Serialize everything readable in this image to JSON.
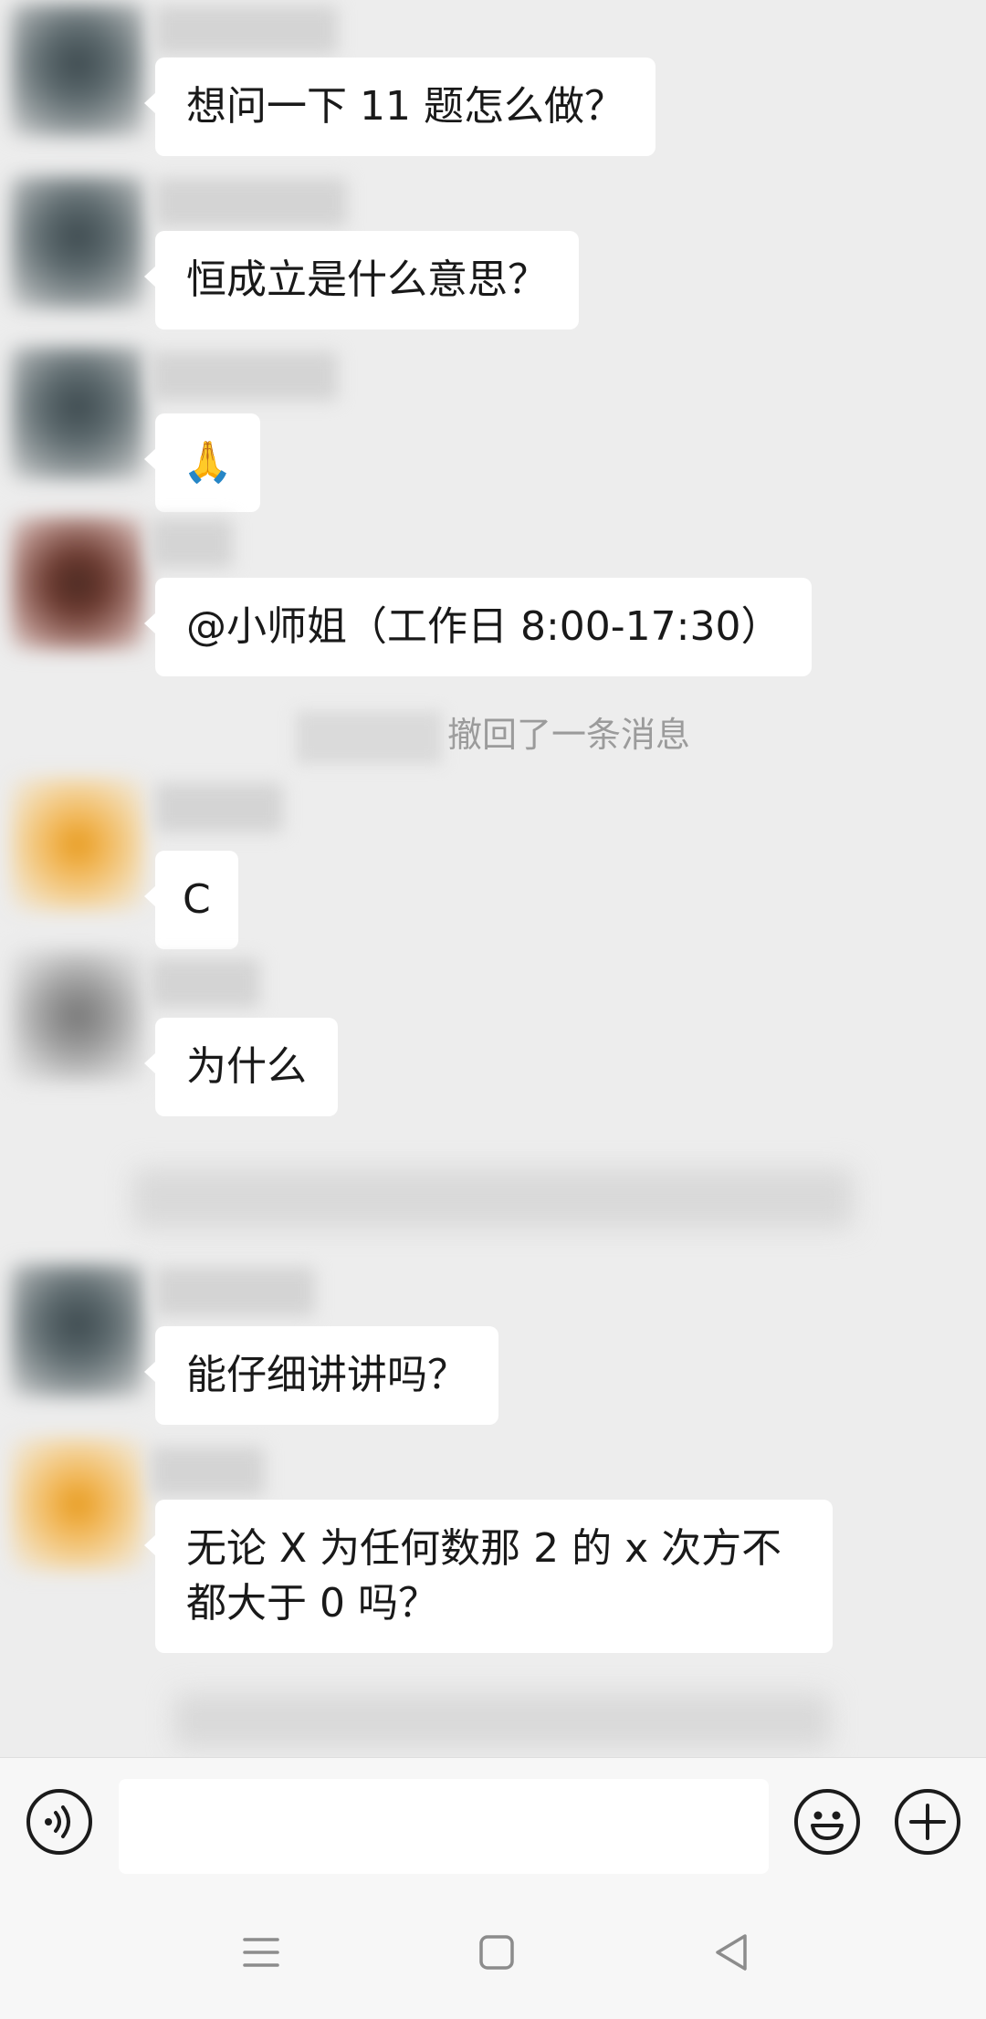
{
  "messages": [
    {
      "text": "想问一下 11 题怎么做？"
    },
    {
      "text": "恒成立是什么意思？"
    },
    {
      "emoji": "🙏"
    },
    {
      "text": "@小师姐（工作日 8:00-17:30）"
    },
    {
      "text": "C"
    },
    {
      "text": "为什么"
    },
    {
      "text": "能仔细讲讲吗？"
    },
    {
      "text": "无论 X 为任何数那 2 的 x 次方不都大于 0 吗？"
    }
  ],
  "system_notice": "撤回了一条消息",
  "icons": {
    "voice": "voice-icon",
    "emoji": "emoji-icon",
    "plus": "plus-icon",
    "menu": "menu-icon",
    "home": "home-icon",
    "back": "back-icon"
  },
  "colors": {
    "background": "#ededed",
    "bubble": "#ffffff",
    "text": "#191919",
    "notice": "#9b9b9b"
  }
}
